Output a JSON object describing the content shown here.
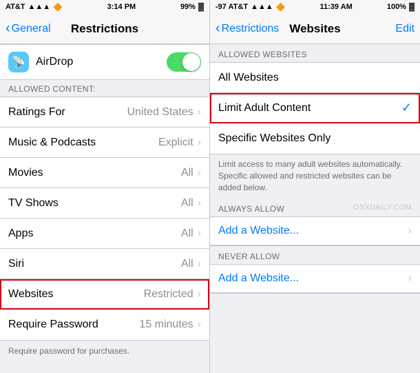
{
  "left": {
    "status_bar": {
      "carrier": "AT&T",
      "signal": "●●●●○",
      "wifi": "WiFi",
      "time": "3:14 PM",
      "battery": "99%"
    },
    "nav": {
      "back_label": "General",
      "title": "Restrictions"
    },
    "airdrop": {
      "label": "AirDrop",
      "icon": "📡"
    },
    "allowed_content_header": "ALLOWED CONTENT:",
    "items": [
      {
        "label": "Ratings For",
        "value": "United States",
        "highlighted": false
      },
      {
        "label": "Music & Podcasts",
        "value": "Explicit",
        "highlighted": false
      },
      {
        "label": "Movies",
        "value": "All",
        "highlighted": false
      },
      {
        "label": "TV Shows",
        "value": "All",
        "highlighted": false
      },
      {
        "label": "Apps",
        "value": "All",
        "highlighted": false
      },
      {
        "label": "Siri",
        "value": "All",
        "highlighted": false
      },
      {
        "label": "Websites",
        "value": "Restricted",
        "highlighted": true
      },
      {
        "label": "Require Password",
        "value": "15 minutes",
        "highlighted": false
      }
    ],
    "bottom_note": "Require password for purchases."
  },
  "right": {
    "status_bar": {
      "carrier": "-97 AT&T",
      "signal": "●●●●○",
      "wifi": "WiFi",
      "time": "11:39 AM",
      "battery": "100%"
    },
    "nav": {
      "back_label": "Restrictions",
      "title": "Websites",
      "edit_label": "Edit"
    },
    "allowed_section_header": "ALLOWED WEBSITES",
    "website_options": [
      {
        "label": "All Websites",
        "selected": false
      },
      {
        "label": "Limit Adult Content",
        "selected": true
      },
      {
        "label": "Specific Websites Only",
        "selected": false
      }
    ],
    "description": "Limit access to many adult websites automatically. Specific allowed and restricted websites can be added below.",
    "watermark": "osxdaily.com",
    "always_allow_header": "ALWAYS ALLOW",
    "never_allow_header": "NEVER ALLOW",
    "add_website_label": "Add a Website..."
  }
}
